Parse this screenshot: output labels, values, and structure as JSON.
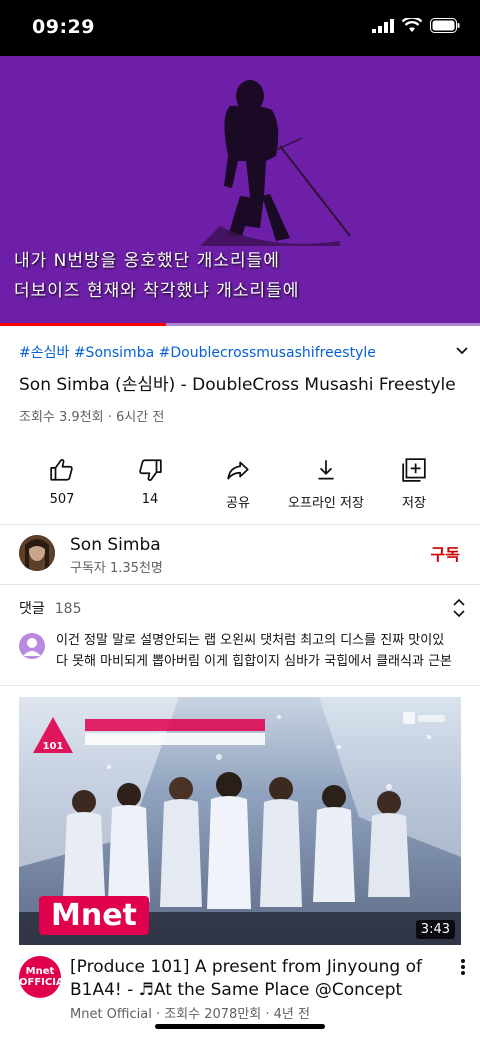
{
  "status_bar": {
    "time": "09:29"
  },
  "video": {
    "subtitle_line1": "내가 N번방을 옹호했단 개소리들에",
    "subtitle_line2": "더보이즈 현재와 착각했냐 개소리들에",
    "progress_fraction": 0.345
  },
  "meta": {
    "hashtags": "#손심바 #Sonsimba #Doublecrossmusashifreestyle",
    "title": "Son Simba (손심바) - DoubleCross Musashi Freestyle",
    "views": "조회수 3.9천회 · 6시간 전"
  },
  "actions": {
    "like_count": "507",
    "dislike_count": "14",
    "share_label": "공유",
    "offline_label": "오프라인 저장",
    "save_label": "저장"
  },
  "channel": {
    "name": "Son Simba",
    "subscribers": "구독자 1.35천명",
    "subscribe_label": "구독"
  },
  "comments": {
    "label": "댓글",
    "count": "185",
    "preview": "이건 정말 말로 설명안되는 랩 오왼씨 댓처럼 최고의 디스를 진짜 맛이있다 못해 마비되게 뽑아버림 이게 힙합이지 심바가 국힙에서 클래식과 근본적..."
  },
  "next_video": {
    "duration": "3:43",
    "thumb_logo": "Mnet",
    "channel_avatar_text": "Mnet OFFICIAL",
    "title": "[Produce 101] A present from Jinyoung of B1A4! - ♬At the Same Place @Concept Eva...",
    "meta": "Mnet Official · 조회수 2078만회 · 4년 전"
  },
  "colors": {
    "video_bg": "#6e1fa8",
    "hashtag": "#065fd4",
    "subscribe": "#cc0000",
    "mnet_pink": "#e0004d"
  }
}
